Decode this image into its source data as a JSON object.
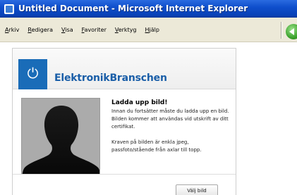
{
  "window": {
    "title": "Untitled Document - Microsoft Internet Explorer"
  },
  "menu": {
    "items": [
      {
        "label": "Arkiv",
        "accel": "A",
        "rest": "rkiv"
      },
      {
        "label": "Redigera",
        "accel": "R",
        "rest": "edigera"
      },
      {
        "label": "Visa",
        "accel": "V",
        "rest": "isa"
      },
      {
        "label": "Favoriter",
        "accel": "F",
        "rest": "avoriter"
      },
      {
        "label": "Verktyg",
        "accel": "V",
        "rest": "erktyg"
      },
      {
        "label": "Hjälp",
        "accel": "H",
        "rest": "jälp"
      }
    ]
  },
  "page": {
    "brand": "ElektronikBranschen",
    "upload_title": "Ladda upp bild!",
    "description": "Innan du fortsätter måste du ladda upp en bild. Bilden kommer att användas vid utskrift av ditt certifikat.",
    "requirements": "Kraven på bilden är enkla jpeg, passfoto/stående från axlar till topp.",
    "choose_button": "Välj bild"
  },
  "icons": {
    "title": "ie-document-icon",
    "logo": "power-icon",
    "back": "back-arrow-icon",
    "photo": "person-silhouette-icon"
  },
  "colors": {
    "titlebar": "#0842b8",
    "brand": "#1a5ea8",
    "logo_box": "#1a6cb8",
    "back_button": "#3ca22d"
  }
}
